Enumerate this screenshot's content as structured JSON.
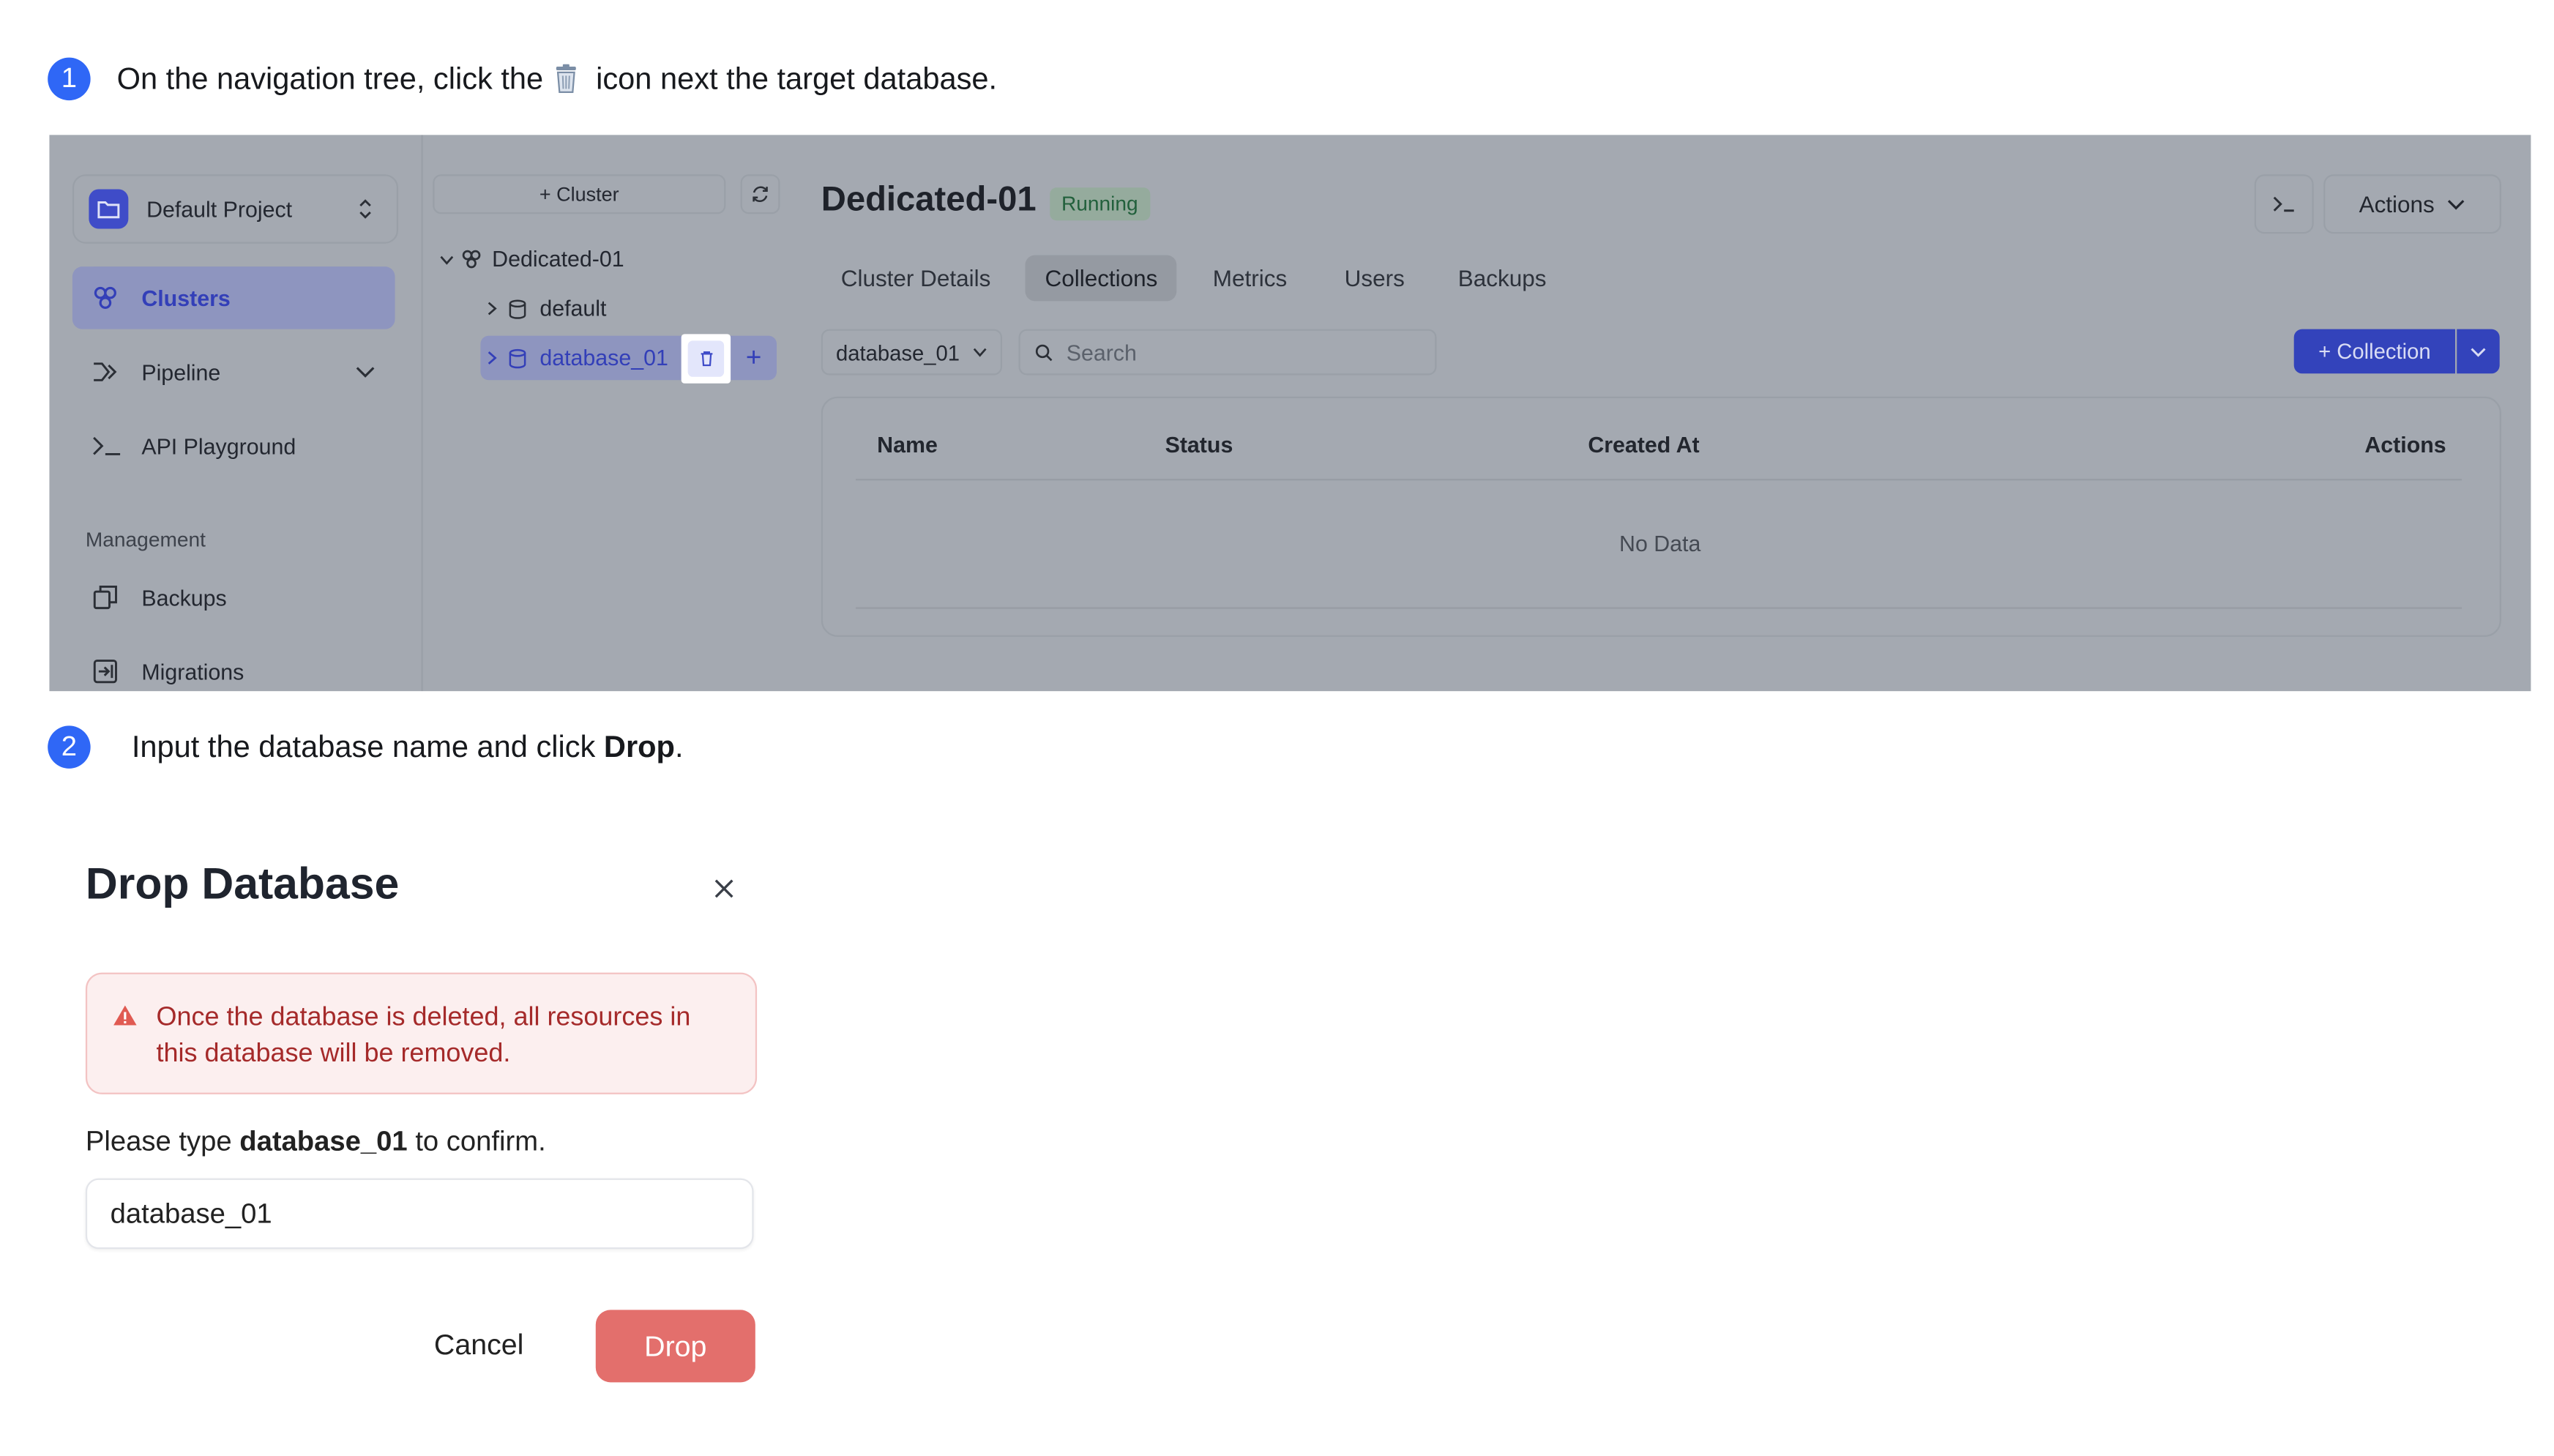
{
  "steps": [
    {
      "number": "1",
      "text_before": "On the navigation tree, click the",
      "text_after": "icon next the target database.",
      "icon": "trash-icon"
    },
    {
      "number": "2",
      "text_before": "Input the database name and click ",
      "bold": "Drop",
      "text_after": "."
    }
  ],
  "screenshot": {
    "sidebar": {
      "project": "Default Project",
      "items": [
        {
          "label": "Clusters",
          "icon": "clusters-icon",
          "active": true
        },
        {
          "label": "Pipeline",
          "icon": "pipeline-icon"
        },
        {
          "label": "API Playground",
          "icon": "terminal-icon"
        }
      ],
      "section_label": "Management",
      "management_items": [
        {
          "label": "Backups",
          "icon": "backups-icon"
        },
        {
          "label": "Migrations",
          "icon": "migrations-icon"
        }
      ]
    },
    "tree": {
      "cluster_button": "+ Cluster",
      "cluster_name": "Dedicated-01",
      "databases": [
        "default",
        "database_01"
      ]
    },
    "main": {
      "title": "Dedicated-01",
      "status": "Running",
      "actions_label": "Actions",
      "tabs": [
        "Cluster Details",
        "Collections",
        "Metrics",
        "Users",
        "Backups"
      ],
      "active_tab": "Collections",
      "db_select": "database_01",
      "search_placeholder": "Search",
      "collection_button": "+ Collection",
      "table_headers": [
        "Name",
        "Status",
        "Created At",
        "Actions"
      ],
      "empty_text": "No Data"
    }
  },
  "dialog": {
    "title": "Drop Database",
    "warning": "Once the database is deleted, all resources in this database will be removed.",
    "confirm_before": "Please type ",
    "confirm_name": "database_01",
    "confirm_after": " to confirm.",
    "input_value": "database_01",
    "cancel_label": "Cancel",
    "drop_label": "Drop"
  },
  "colors": {
    "step_badge": "#2f67f6",
    "accent": "#3f4cc8",
    "danger": "#e36f6c",
    "warning_text": "#a52a2a"
  }
}
